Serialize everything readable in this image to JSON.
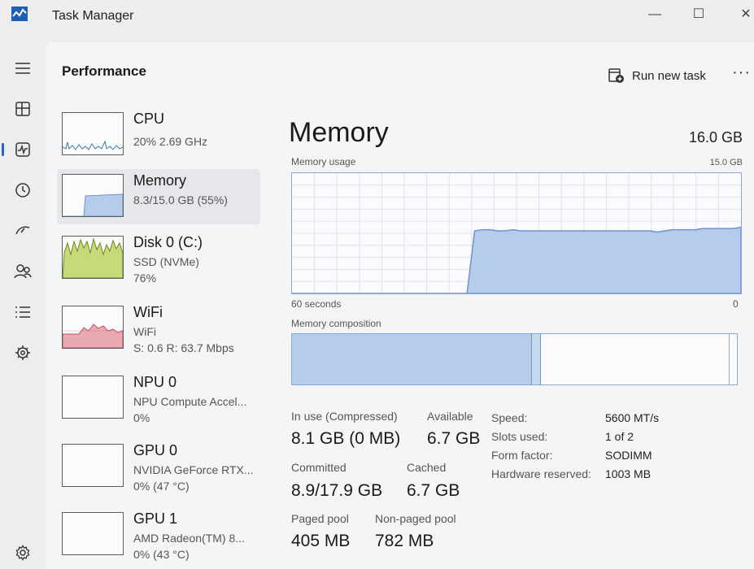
{
  "app": {
    "title": "Task Manager"
  },
  "window": {
    "minimize": "—",
    "maximize": "☐",
    "close": "✕"
  },
  "nav": {
    "items": [
      "menu-icon",
      "processes-icon",
      "performance-icon",
      "app-history-icon",
      "startup-icon",
      "users-icon",
      "details-icon",
      "services-icon",
      "settings-icon"
    ],
    "active": "performance-icon"
  },
  "header": {
    "title": "Performance",
    "run_task": "Run new task",
    "more": "···"
  },
  "devices": [
    {
      "name": "CPU",
      "sub1": "20%  2.69 GHz",
      "sub2": ""
    },
    {
      "name": "Memory",
      "sub1": "8.3/15.0 GB (55%)",
      "sub2": ""
    },
    {
      "name": "Disk 0 (C:)",
      "sub1": "SSD (NVMe)",
      "sub2": "76%"
    },
    {
      "name": "WiFi",
      "sub1": "WiFi",
      "sub2": "S: 0.6  R: 63.7 Mbps"
    },
    {
      "name": "NPU 0",
      "sub1": "NPU Compute Accel...",
      "sub2": "0%"
    },
    {
      "name": "GPU 0",
      "sub1": "NVIDIA GeForce RTX...",
      "sub2": "0%  (47 °C)"
    },
    {
      "name": "GPU 1",
      "sub1": "AMD Radeon(TM) 8...",
      "sub2": "0%  (43 °C)"
    }
  ],
  "memory": {
    "title": "Memory",
    "total": "16.0 GB",
    "usage_label": "Memory usage",
    "usage_max": "15.0 GB",
    "axis_left": "60 seconds",
    "axis_right": "0",
    "composition_label": "Memory composition",
    "usage_history_fraction": [
      0,
      0,
      0,
      0,
      0,
      0,
      0,
      0,
      0,
      0,
      0,
      0,
      0,
      0,
      0,
      0,
      0,
      0,
      0,
      0,
      0,
      0,
      0,
      0,
      0.52,
      0.53,
      0.53,
      0.52,
      0.52,
      0.53,
      0.52,
      0.52,
      0.52,
      0.52,
      0.52,
      0.52,
      0.52,
      0.52,
      0.52,
      0.52,
      0.52,
      0.52,
      0.52,
      0.52,
      0.52,
      0.52,
      0.52,
      0.52,
      0.51,
      0.52,
      0.53,
      0.53,
      0.53,
      0.53,
      0.54,
      0.54,
      0.54,
      0.54,
      0.54,
      0.55
    ],
    "composition_fraction": {
      "in_use": 0.54,
      "modified": 0.02,
      "standby": 0.44
    },
    "stats": {
      "in_use_label": "In use (Compressed)",
      "in_use_value": "8.1 GB (0 MB)",
      "available_label": "Available",
      "available_value": "6.7 GB",
      "committed_label": "Committed",
      "committed_value": "8.9/17.9 GB",
      "cached_label": "Cached",
      "cached_value": "6.7 GB",
      "paged_label": "Paged pool",
      "paged_value": "405 MB",
      "nonpaged_label": "Non-paged pool",
      "nonpaged_value": "782 MB"
    },
    "details": [
      {
        "key": "Speed:",
        "value": "5600 MT/s"
      },
      {
        "key": "Slots used:",
        "value": "1 of 2"
      },
      {
        "key": "Form factor:",
        "value": "SODIMM"
      },
      {
        "key": "Hardware reserved:",
        "value": "1003 MB"
      }
    ]
  },
  "colors": {
    "accent": "#2a5ec9",
    "memory_fill": "#b5cceb",
    "memory_line": "#6e93cf",
    "disk_fill": "#c6da7a",
    "disk_line": "#6c8a12",
    "wifi_fill": "#e8aab2",
    "wifi_line": "#c0505e",
    "cpu_line": "#3a7fa6"
  }
}
